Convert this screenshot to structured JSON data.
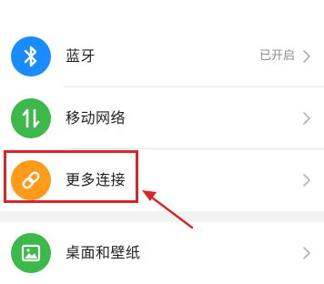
{
  "settings": {
    "items": [
      {
        "label": "蓝牙",
        "status": "已开启",
        "icon": "bluetooth-icon",
        "color": "#1a8cff"
      },
      {
        "label": "移动网络",
        "status": "",
        "icon": "mobile-data-icon",
        "color": "#3db94c"
      },
      {
        "label": "更多连接",
        "status": "",
        "icon": "link-icon",
        "color": "#ff9a1a"
      },
      {
        "label": "桌面和壁纸",
        "status": "",
        "icon": "wallpaper-icon",
        "color": "#3db94c"
      }
    ]
  },
  "annotation": {
    "highlight_color": "#d9262a",
    "highlighted_item": "更多连接"
  }
}
